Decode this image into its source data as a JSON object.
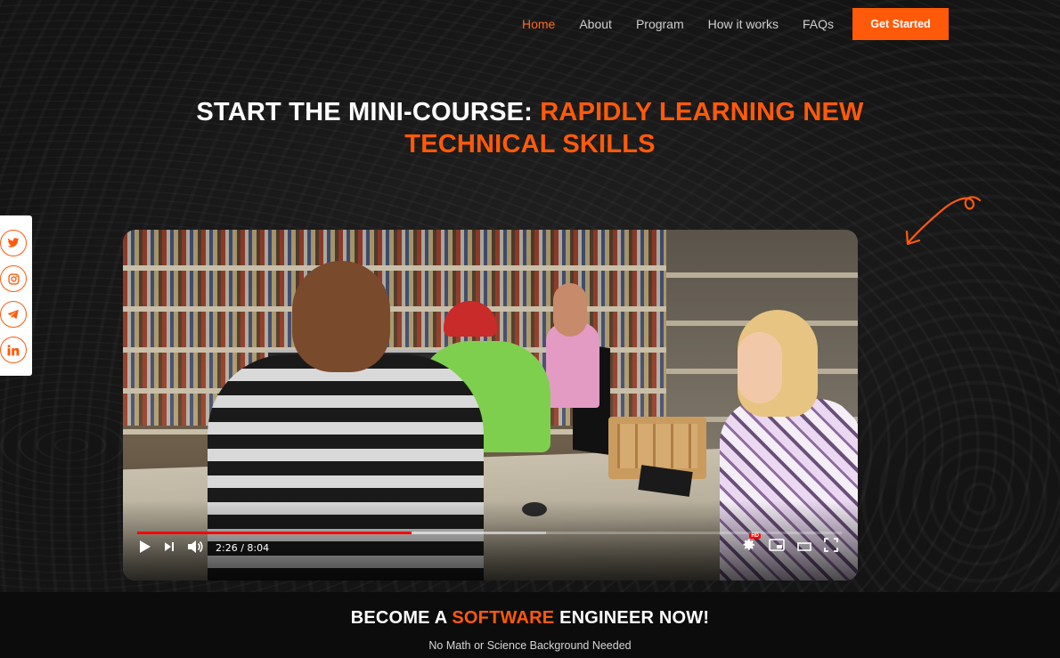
{
  "nav": {
    "items": [
      {
        "label": "Home",
        "active": true
      },
      {
        "label": "About",
        "active": false
      },
      {
        "label": "Program",
        "active": false
      },
      {
        "label": "How it works",
        "active": false
      },
      {
        "label": "FAQs",
        "active": false
      }
    ],
    "cta_label": "Get Started"
  },
  "hero": {
    "title_white": "START THE MINI-COURSE: ",
    "title_orange_line1": "RAPIDLY LEARNING NEW",
    "title_orange_line2": "TECHNICAL SKILLS"
  },
  "social": {
    "icons": [
      "twitter-icon",
      "instagram-icon",
      "telegram-icon",
      "linkedin-icon"
    ]
  },
  "video": {
    "time_display": "2:26 / 8:04",
    "played_fraction": 0.39,
    "loaded_fraction": 0.58,
    "settings_badge": "HD"
  },
  "cta_section": {
    "heading_pre": "BECOME A ",
    "heading_highlight": "SOFTWARE",
    "heading_post": " ENGINEER NOW!",
    "subtext": "No Math or Science Background Needed"
  },
  "colors": {
    "accent": "#ff5a0a",
    "background": "#121212",
    "progress_played": "#ff0000"
  }
}
